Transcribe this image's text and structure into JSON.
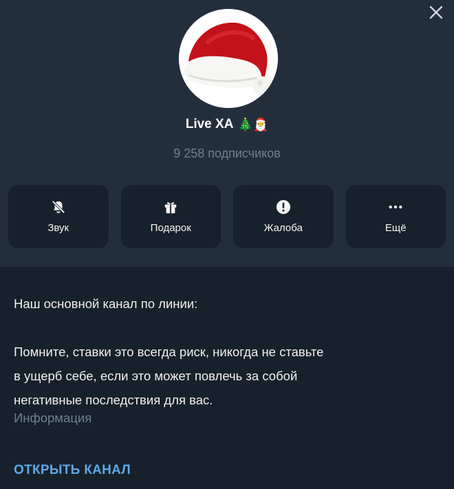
{
  "channel": {
    "name": "Live XA",
    "name_emoji": "🎄🎅",
    "subscribers": "9 258 подписчиков"
  },
  "actions": [
    {
      "label": "Звук",
      "icon": "bell-muted-icon"
    },
    {
      "label": "Подарок",
      "icon": "gift-icon"
    },
    {
      "label": "Жалоба",
      "icon": "report-icon"
    },
    {
      "label": "Ещё",
      "icon": "more-icon"
    }
  ],
  "about": {
    "line1": "Наш основной канал по линии:",
    "line2": "Помните, ставки это всегда риск, никогда не ставьте",
    "line3": "в ущерб себе, если это может повлечь за собой",
    "line4": "негативные последствия для вас.",
    "label": "Информация"
  },
  "open_channel": "ОТКРЫТЬ КАНАЛ",
  "colors": {
    "background": "#17212b",
    "panel": "#232e3c",
    "muted_text": "#6f7f90",
    "link": "#5fa8e8"
  }
}
